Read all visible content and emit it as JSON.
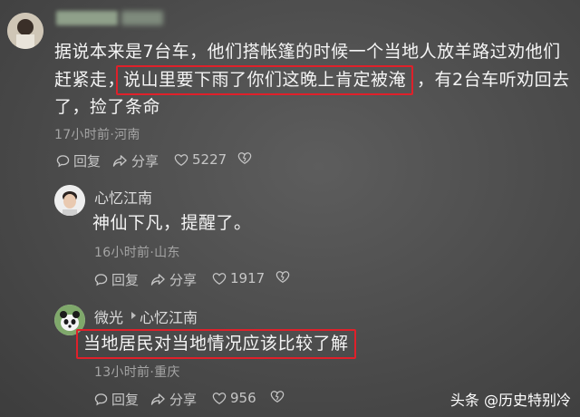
{
  "comments": [
    {
      "text_lines": [
        "据说本来是7台车，他们搭帐篷的时候一个当地人放羊路过劝他们",
        "赶紧走，",
        "说山里要下雨了你们这晚上肯定被淹",
        "，有2台车听劝回去",
        "了，捡了条命"
      ],
      "meta": "17小时前·河南",
      "actions": {
        "reply": "回复",
        "share": "分享",
        "likes": "5227"
      }
    },
    {
      "user": "心忆江南",
      "text": "神仙下凡，提醒了。",
      "meta": "16小时前·山东",
      "actions": {
        "reply": "回复",
        "share": "分享",
        "likes": "1917"
      }
    },
    {
      "user": "微光",
      "reply_to": "心忆江南",
      "text": "当地居民对当地情况应该比较了解",
      "meta": "13小时前·重庆",
      "actions": {
        "reply": "回复",
        "share": "分享",
        "likes": "956"
      }
    }
  ],
  "watermark": "头条 @历史特别冷",
  "colors": {
    "highlight": "#e0202a",
    "background": "#4b4b4b"
  }
}
